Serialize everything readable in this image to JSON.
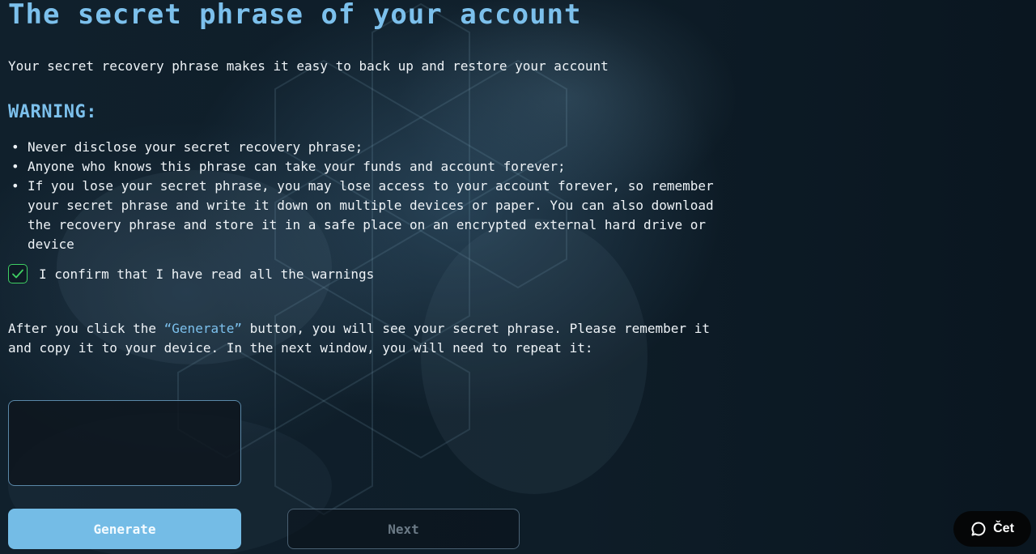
{
  "page": {
    "title": "The secret phrase of your account",
    "subtitle": "Your secret recovery phrase makes it easy to back up and restore your account"
  },
  "warning": {
    "heading": "WARNING:",
    "items": [
      "Never disclose your secret recovery phrase;",
      "Anyone who knows this phrase can take your funds and account forever;",
      "If you lose your secret phrase, you may lose access to your account forever, so remember your secret phrase and write it down on multiple devices or paper. You can also download the recovery phrase and store it in a safe place on an encrypted external hard drive or device"
    ]
  },
  "confirm": {
    "label": "I confirm that I have read all the warnings",
    "checked": true
  },
  "info": {
    "before": "After you click the ",
    "highlight": "“Generate”",
    "after": " button, you will see your secret phrase. Please remember it and copy it to your device. In the next window, you will need to repeat it:"
  },
  "phrase_box": {
    "value": ""
  },
  "buttons": {
    "generate": "Generate",
    "next": "Next"
  },
  "chat": {
    "label": "Čet",
    "icon": "chat-bubble-icon"
  },
  "colors": {
    "accent": "#7cc0ec",
    "generate_button": "#74bce6",
    "checkbox": "#3fcf63",
    "background": "#0c1a24"
  }
}
